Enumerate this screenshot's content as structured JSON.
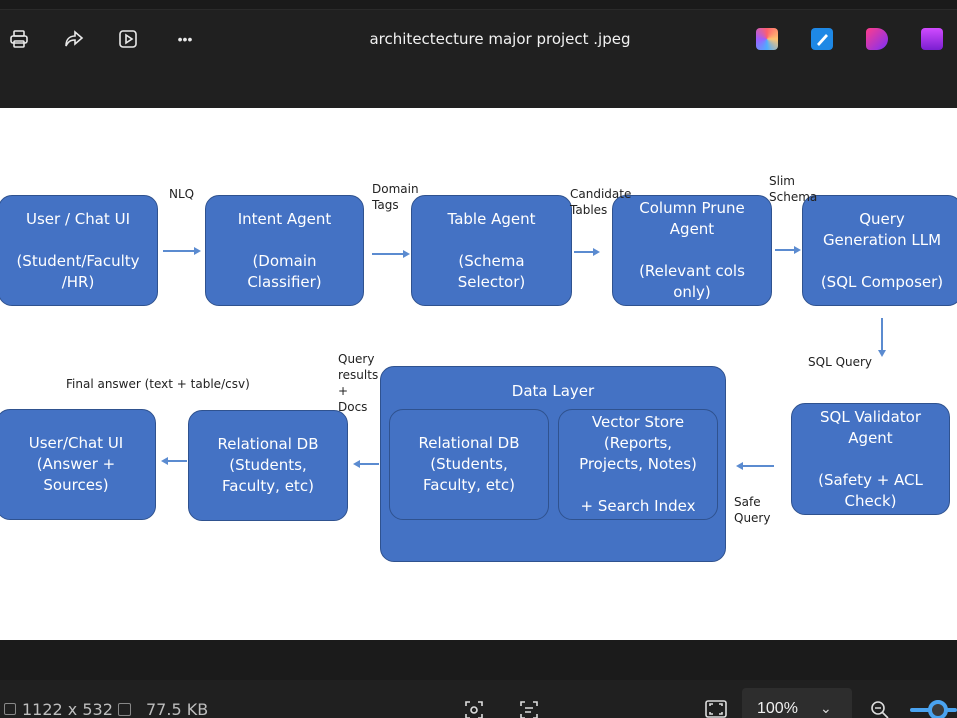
{
  "window": {
    "filename": "architectecture major project .jpeg"
  },
  "toolbar": {
    "print_icon": "print-icon",
    "share_icon": "share-icon",
    "slideshow_icon": "slideshow-icon",
    "more_label": "•••"
  },
  "diagram": {
    "boxes": {
      "user_chat": "User / Chat UI\n\n(Student/Faculty\n/HR)",
      "intent": "Intent Agent\n\n(Domain\nClassifier)",
      "table": "Table Agent\n\n(Schema\nSelector)",
      "column": "Column Prune\nAgent\n\n(Relevant cols\nonly)",
      "query_gen": "Query\nGeneration LLM\n\n(SQL Composer)",
      "validator": "SQL Validator\nAgent\n\n(Safety + ACL\nCheck)",
      "data_layer": "Data Layer",
      "relational_inner": "Relational DB\n(Students,\nFaculty, etc)",
      "vector_store": "Vector Store\n(Reports,\nProjects, Notes)\n\n+ Search Index",
      "relational_db": "Relational DB\n(Students,\nFaculty, etc)",
      "user_answer": "User/Chat UI\n(Answer +\nSources)"
    },
    "labels": {
      "nlq": "NLQ",
      "domain_tags": "Domain\nTags",
      "candidate_tables": "Candidate\nTables",
      "slim_schema": "Slim\nSchema",
      "sql_query": "SQL Query",
      "safe_query": "Safe\nQuery",
      "query_results": "Query\nresults\n+\nDocs",
      "final_answer": "Final answer (text + table/csv)"
    }
  },
  "status": {
    "dimensions": "1122 x 532",
    "file_size": "77.5 KB",
    "zoom": "100%",
    "zoom_level": 0.5
  }
}
